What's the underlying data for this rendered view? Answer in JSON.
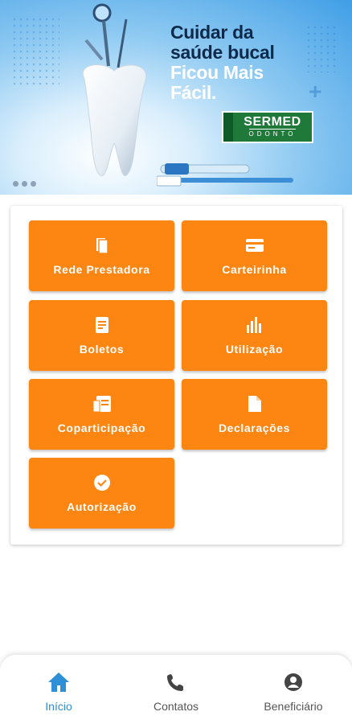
{
  "banner": {
    "headline_line1": "Cuidar da",
    "headline_line2": "saúde bucal",
    "headline_line3": "Ficou Mais",
    "headline_line4": "Fácil.",
    "logo_title": "SERMED",
    "logo_subtitle": "ODONTO",
    "carousel_total": 3,
    "carousel_active": 1
  },
  "menu": {
    "items": [
      {
        "label": "Rede Prestadora",
        "icon": "book-icon"
      },
      {
        "label": "Carteirinha",
        "icon": "card-icon"
      },
      {
        "label": "Boletos",
        "icon": "document-icon"
      },
      {
        "label": "Utilização",
        "icon": "bar-chart-icon"
      },
      {
        "label": "Coparticipação",
        "icon": "receipt-icon"
      },
      {
        "label": "Declarações",
        "icon": "file-icon"
      },
      {
        "label": "Autorização",
        "icon": "check-circle-icon"
      }
    ]
  },
  "bottom_nav": {
    "items": [
      {
        "label": "Início",
        "icon": "home-icon",
        "active": true
      },
      {
        "label": "Contatos",
        "icon": "phone-icon",
        "active": false
      },
      {
        "label": "Beneficiário",
        "icon": "user-circle-icon",
        "active": false
      }
    ]
  },
  "colors": {
    "primary_orange": "#fd8512",
    "active_blue": "#2e8fd6",
    "inactive_gray": "#555555"
  }
}
